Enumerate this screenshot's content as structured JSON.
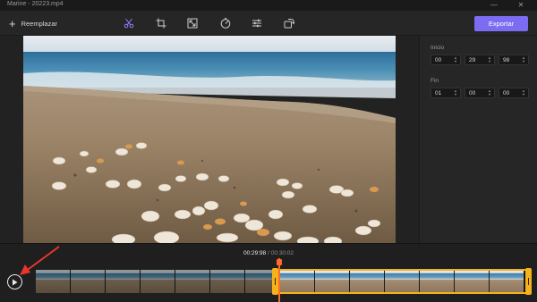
{
  "window": {
    "title": "Marine - 20223.mp4",
    "minimize_glyph": "—",
    "close_glyph": "✕"
  },
  "toolbar": {
    "replace_label": "Reemplazar",
    "export_label": "Exportar",
    "tools": [
      "scissors-icon",
      "crop-icon",
      "resize-icon",
      "speed-icon",
      "adjust-icon",
      "rotate-icon"
    ],
    "accent": "#7b6cf2"
  },
  "panel": {
    "start_label": "Inicio",
    "start": {
      "h": "00",
      "m": "29",
      "s": "98"
    },
    "end_label": "Fin",
    "end": {
      "h": "01",
      "m": "00",
      "s": "00"
    }
  },
  "timeline": {
    "current_time": "00:29:98",
    "separator": " / ",
    "total_time": "00:30:02",
    "selection_color": "#f6b21a",
    "playhead_color": "#ff6a2a"
  },
  "annotation": {
    "arrow_color": "#e8362d"
  }
}
